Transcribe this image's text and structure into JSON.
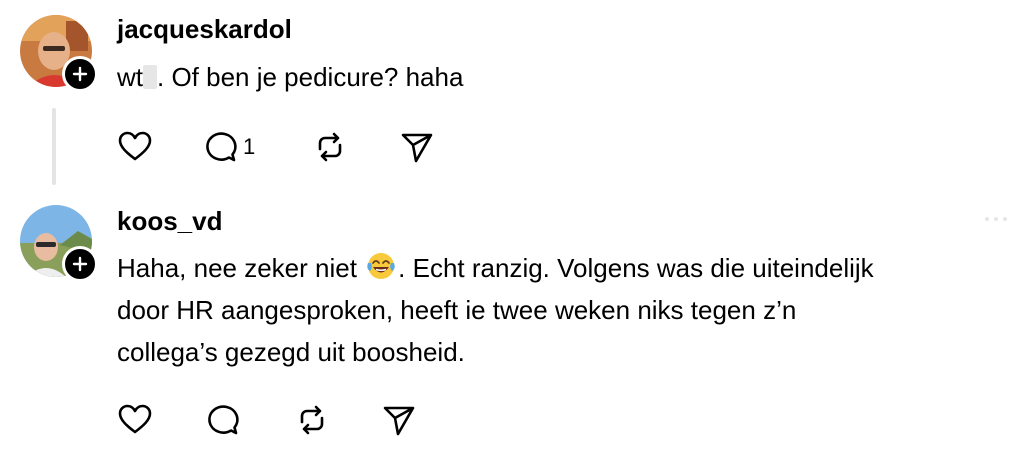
{
  "comments": [
    {
      "username": "jacqueskardol",
      "text_before_redaction": "wt",
      "text_after_redaction": ". Of ben je pedicure? haha",
      "reply_count": "1"
    },
    {
      "username": "koos_vd",
      "text_line1_before_emoji": "Haha, nee zeker niet",
      "emoji": "😂",
      "text_line1_after_emoji": ". Echt ranzig. Volgens was die uiteindelijk",
      "text_line2": "door HR aangesproken, heeft ie twee weken niks tegen z’n",
      "text_line3": "collega’s gezegd uit boosheid."
    }
  ],
  "icons": {
    "follow": "plus-icon",
    "like": "heart-icon",
    "reply": "speech-bubble-icon",
    "repost": "repost-icon",
    "share": "paper-plane-icon",
    "more": "ellipsis-icon"
  },
  "colors": {
    "text": "#000000",
    "thread_line": "#e4e4e4",
    "background": "#ffffff"
  }
}
